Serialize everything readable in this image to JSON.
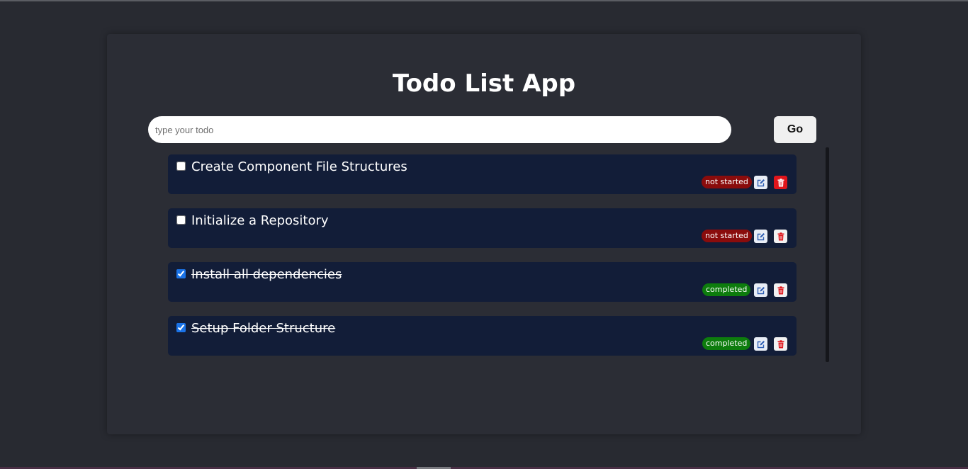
{
  "app": {
    "title": "Todo List App"
  },
  "form": {
    "input_value": "",
    "input_placeholder": "type your todo",
    "submit_label": "Go"
  },
  "todos": [
    {
      "text": "Create Component File Structures",
      "checked": false,
      "status": "not started",
      "status_color": "#8a0c0c"
    },
    {
      "text": "Initialize a Repository",
      "checked": false,
      "status": "not started",
      "status_color": "#8a0c0c"
    },
    {
      "text": "Install all dependencies",
      "checked": true,
      "status": "completed",
      "status_color": "#0d7c0d"
    },
    {
      "text": "Setup Folder Structure",
      "checked": true,
      "status": "completed",
      "status_color": "#0d7c0d"
    }
  ],
  "icons": {
    "edit": "edit-icon",
    "delete": "trash-icon"
  },
  "colors": {
    "background": "#282a31",
    "card": "#2b2d35",
    "todo_item": "#121d38",
    "edit_icon": "#2f5fb3",
    "delete_icon": "#e0151b"
  }
}
